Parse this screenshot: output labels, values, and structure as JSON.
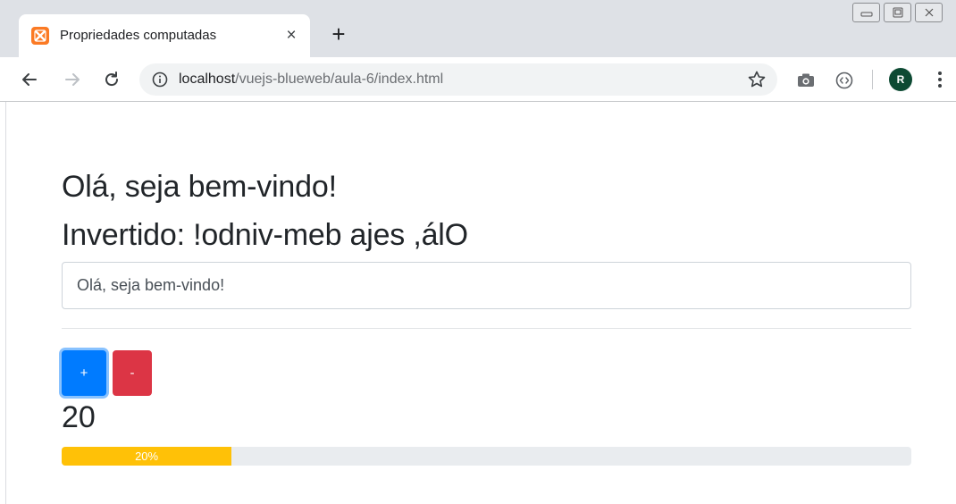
{
  "browser": {
    "tab": {
      "title": "Propriedades computadas",
      "favicon": "xampp-icon"
    },
    "url": {
      "host": "localhost",
      "path": "/vuejs-blueweb/aula-6/index.html"
    },
    "profile_initial": "R",
    "accent": "#fb7a24"
  },
  "page": {
    "greeting": "Olá, seja bem-vindo!",
    "reversed": "Invertido: !odniv-meb ajes ,álO",
    "input_value": "Olá, seja bem-vindo!",
    "buttons": {
      "increment_label": "+",
      "decrement_label": "-"
    },
    "counter": "20",
    "progress": {
      "value_percent": 20,
      "label": "20%"
    },
    "colors": {
      "primary": "#007bff",
      "danger": "#dc3545",
      "warning": "#ffc107"
    }
  }
}
